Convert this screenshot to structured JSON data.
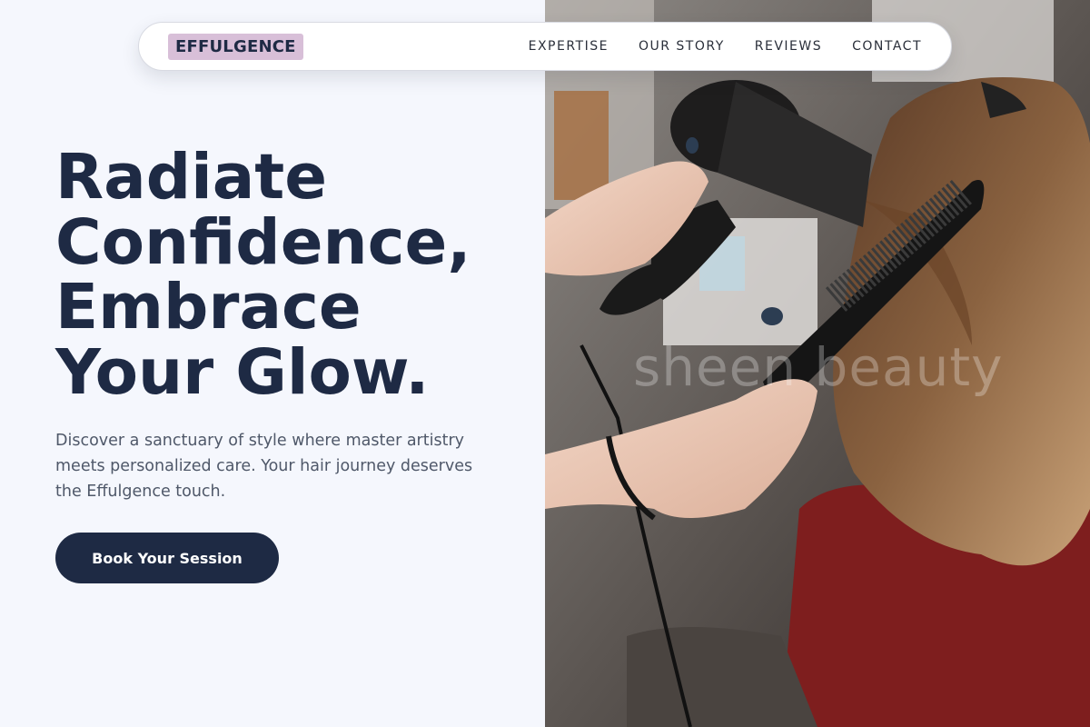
{
  "brand": {
    "name": "EFFULGENCE"
  },
  "nav": {
    "items": [
      {
        "label": "EXPERTISE"
      },
      {
        "label": "OUR STORY"
      },
      {
        "label": "REVIEWS"
      },
      {
        "label": "CONTACT"
      }
    ]
  },
  "hero": {
    "headline": [
      "Radiate",
      "Confidence,",
      "Embrace",
      "Your Glow."
    ],
    "description": "Discover a sanctuary of style where master artistry meets personalized care. Your hair journey deserves the Effulgence touch.",
    "cta_label": "Book Your Session",
    "image_watermark": "sheen beauty"
  },
  "colors": {
    "background": "#f5f7fd",
    "primary": "#1e2a44",
    "brand_highlight": "#d8bfd8",
    "body_text": "#4f5869"
  }
}
